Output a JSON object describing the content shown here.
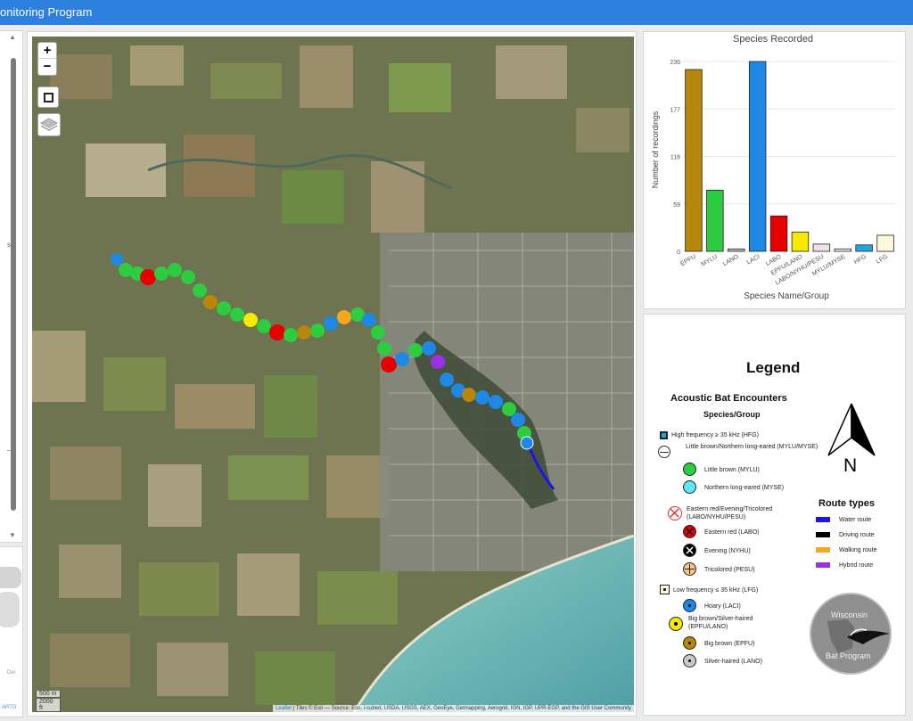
{
  "header": {
    "title": "onitoring Program"
  },
  "map": {
    "zoom_in": "+",
    "zoom_out": "−",
    "scale_m": "500 m",
    "scale_ft": "2000 ft",
    "attribution_link": "Leaflet",
    "attribution_text": "| Tiles © Esri — Source: Esri, i-cubed, USDA, USGS, AEX, GeoEye, Getmapping, Aerogrid, IGN, IGP, UPR-EGP, and the GIS User Community"
  },
  "left_panel": {
    "small_label": "s",
    "mini_label_1": "Del",
    "mini_label_2": "ARTO"
  },
  "chart_data": {
    "type": "bar",
    "title": "Species Recorded",
    "xlabel": "Species Name/Group",
    "ylabel": "Number of recordings",
    "ylim": [
      0,
      236
    ],
    "yticks": [
      0,
      59,
      118,
      177,
      236
    ],
    "categories": [
      "EPFU",
      "MYLU",
      "LANO",
      "LACI",
      "LABO",
      "EPFU/LANO",
      "LABO/NYHU/PESU",
      "MYLU/MYSE",
      "HFG",
      "LFG"
    ],
    "values": [
      226,
      76,
      3,
      236,
      44,
      24,
      9,
      3,
      8,
      20
    ],
    "colors": [
      "#b8860b",
      "#2ecc40",
      "#bdbdbd",
      "#1e88e5",
      "#e60000",
      "#f5ea00",
      "#ece1ec",
      "#f0f0f0",
      "#1ea7e1",
      "#fbf8dc"
    ],
    "grid": true
  },
  "legend": {
    "title": "Legend",
    "subtitle": "Acoustic Bat Encounters",
    "subtitle2": "Species/Group",
    "hfg": "High frequency ≥ 35 kHz (HFG)",
    "mylu_myse": "Little brown/Northern long-eared (MYLU/MYSE)",
    "mylu": "Little brown (MYLU)",
    "myse": "Northern long-eared (MYSE)",
    "labo_group": "Eastern red/Evening/Tricolored (LABO/NYHU/PESU)",
    "labo": "Eastern red (LABO)",
    "nyhu": "Evening (NYHU)",
    "pesu": "Tricolored (PESU)",
    "lfg": "Low frequency ≤ 35 kHz (LFG)",
    "laci": "Hoary (LACI)",
    "epfu_lano": "Big brown/Silver-haired (EPFU/LANO)",
    "epfu": "Big brown (EPFU)",
    "lano": "Silver-haired (LANO)",
    "north": "N",
    "route_title": "Route types",
    "routes": [
      {
        "label": "Water route",
        "color": "#1d16e0"
      },
      {
        "label": "Driving route",
        "color": "#000000"
      },
      {
        "label": "Walking route",
        "color": "#f5a623"
      },
      {
        "label": "Hybrid route",
        "color": "#9b30e8"
      }
    ],
    "logo_top": "Wisconsin",
    "logo_bottom": "Bat Program"
  }
}
